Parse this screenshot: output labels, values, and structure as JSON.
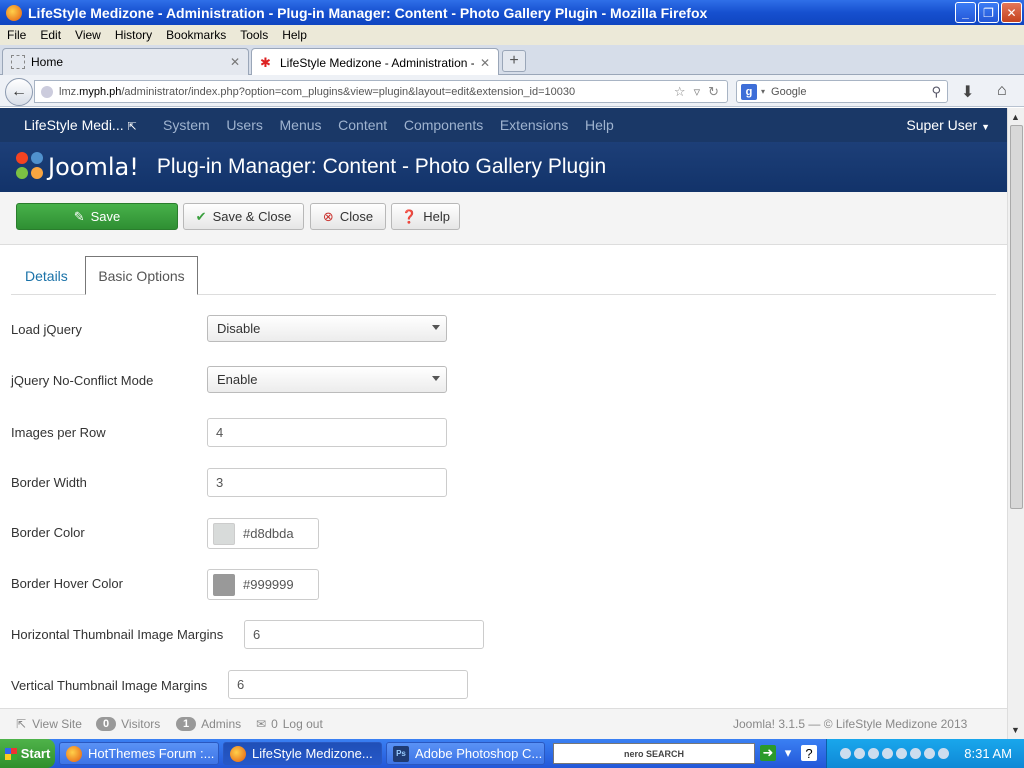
{
  "window": {
    "title": "LifeStyle Medizone - Administration - Plug-in Manager: Content - Photo Gallery Plugin - Mozilla Firefox"
  },
  "menubar": [
    "File",
    "Edit",
    "View",
    "History",
    "Bookmarks",
    "Tools",
    "Help"
  ],
  "browser_tabs": [
    {
      "label": "Home"
    },
    {
      "label": "LifeStyle Medizone - Administration - Plug..."
    }
  ],
  "navbar": {
    "url_prefix": "lmz.",
    "url_domain": "myph.ph",
    "url_rest": "/administrator/index.php?option=com_plugins&view=plugin&layout=edit&extension_id=10030",
    "search_placeholder": "Google"
  },
  "joomla": {
    "site_name": "LifeStyle Medi...",
    "menu": [
      "System",
      "Users",
      "Menus",
      "Content",
      "Components",
      "Extensions",
      "Help"
    ],
    "user": "Super User",
    "logo_text": "Joomla!",
    "page_title": "Plug-in Manager: Content - Photo Gallery Plugin"
  },
  "toolbar": {
    "save": "Save",
    "save_close": "Save & Close",
    "close": "Close",
    "help": "Help"
  },
  "tabs": {
    "details": "Details",
    "basic_options": "Basic Options"
  },
  "form": {
    "load_jquery": {
      "label": "Load jQuery",
      "value": "Disable"
    },
    "no_conflict": {
      "label": "jQuery No-Conflict Mode",
      "value": "Enable"
    },
    "images_per_row": {
      "label": "Images per Row",
      "value": "4"
    },
    "border_width": {
      "label": "Border Width",
      "value": "3"
    },
    "border_color": {
      "label": "Border Color",
      "value": "#d8dbda"
    },
    "border_hover_color": {
      "label": "Border Hover Color",
      "value": "#999999"
    },
    "h_margins": {
      "label": "Horizontal Thumbnail Image Margins",
      "value": "6"
    },
    "v_margins": {
      "label": "Vertical Thumbnail Image Margins",
      "value": "6"
    }
  },
  "footer": {
    "view_site": "View Site",
    "visitors_count": "0",
    "visitors": "Visitors",
    "admins_count": "1",
    "admins": "Admins",
    "logout_count": "0",
    "logout": "Log out",
    "version": "Joomla! 3.1.5  —  © LifeStyle Medizone 2013"
  },
  "taskbar": {
    "start": "Start",
    "tasks": [
      "HotThemes Forum :...",
      "LifeStyle Medizone...",
      "Adobe Photoshop C..."
    ],
    "nero": "nero SEARCH",
    "clock": "8:31 AM"
  },
  "colors": {
    "joomla_nav": "#1a3867",
    "joomla_header": "#1d3f78",
    "save_green": "#3a9f3e",
    "link_blue": "#1a72a8",
    "border_color_swatch": "#d8dbda",
    "border_hover_swatch": "#999999"
  }
}
